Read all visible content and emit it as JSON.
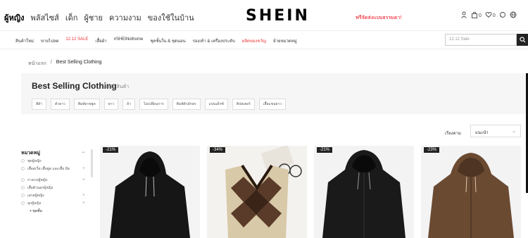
{
  "header": {
    "categories": [
      "ผู้หญิง",
      "พลัสไซส์",
      "เด็ก",
      "ผู้ชาย",
      "ความงาม",
      "ของใช้ในบ้าน"
    ],
    "logo": "SHEIN",
    "promo": "ฟรีจัดส่งแบบธรรมดา!",
    "icons": [
      "user-icon",
      "bag-icon",
      "heart-icon",
      "chat-icon",
      "globe-icon"
    ],
    "bag_count": "0",
    "wish_count": "0"
  },
  "nav": {
    "items": [
      "สินค้าใหม่",
      "ขายไปลด",
      "12.12 SALE",
      "เสื้อผ้า",
      "#SHEINothome",
      "ชุดชั้นใน & ชุดนอน",
      "รองเท้า & เครื่องประดับ",
      "ผลิตของขวัญ",
      "ย้ายหมวดหมู่"
    ],
    "red_indices": [
      2,
      7
    ],
    "search_placeholder": "12.12 Sale"
  },
  "breadcrumb": {
    "home": "หน้าแรก",
    "separator": "/",
    "current": "Best Selling Clothing"
  },
  "title_panel": {
    "title": "Best Selling Clothing",
    "count": "5452 สินค้า",
    "chips": [
      "สีดำ",
      "ตัวยาว",
      "พิมพ์ลายฮูด",
      "ยาว",
      "ผ้า",
      "ไม่เปลี่ยนการ",
      "พิมพ์ตัวอักษร",
      "แปนเด็กซ์",
      "ฮิปสเตอร์",
      "เสื้อแขนยาว"
    ]
  },
  "sort": {
    "label": "เรียงตาม",
    "value": "แนะนำ"
  },
  "sidebar": {
    "heading": "หมวดหมู่",
    "items": [
      {
        "label": "ชุดผู้หญิง",
        "has_plus": false
      },
      {
        "label": "เสื้อสเวิ์ต เสื้อฮูด และเสื้อ มีด",
        "has_plus": true
      },
      {
        "label": "กางเกงผู้หญิง",
        "has_plus": true
      },
      {
        "label": "เสื้อตัวนอกผู้หญิง",
        "has_plus": false
      },
      {
        "label": "เดรสผู้หญิง",
        "has_plus": true
      },
      {
        "label": "ลุกผู้หญิง",
        "has_plus": true
      }
    ],
    "sub_item": "+ ชุดชั้น"
  },
  "products": [
    {
      "discount": "-21%"
    },
    {
      "discount": "-34%"
    },
    {
      "discount": "-21%"
    },
    {
      "discount": "-23%"
    }
  ],
  "colors": {
    "accent_red": "#e33333",
    "dark": "#222222"
  }
}
